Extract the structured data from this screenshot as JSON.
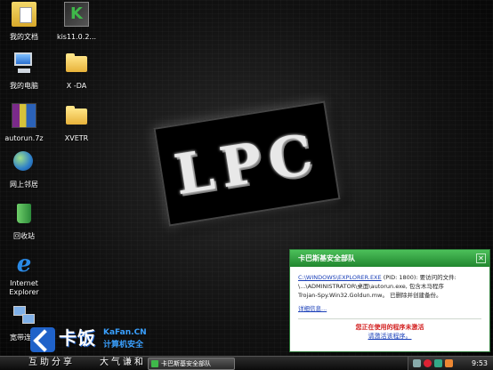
{
  "desktop": {
    "icons": {
      "my_documents": "我的文档",
      "kis_installer": "kis11.0.2...",
      "my_computer": "我的电脑",
      "folder_x_da": "X -DA",
      "autorun": "autorun.7z",
      "folder_xvetr": "XVETR",
      "network_places": "网上邻居",
      "recycle_bin": "回收站",
      "internet_explorer": "Internet Explorer",
      "broadband": "宽带连接"
    },
    "wallpaper_text": "LPC"
  },
  "notification": {
    "title": "卡巴斯基安全部队",
    "path_link": "C:\\WINDOWS\\EXPLORER.EXE",
    "line1_rest": " (PID: 1800): 要访问的文件:",
    "line2": "\\...\\ADMINISTRATOR\\桌面\\autorun.exe, 包含木马程序",
    "line3": "Trojan-Spy.Win32.Goldun.mw。 已删除并创建备份。",
    "details_link": "详细信息...",
    "warning": "您正在使用的程序未激活",
    "activate_link": "请激活该程序。"
  },
  "watermark": {
    "logo_cn": "卡饭",
    "logo_en": "KaFan.CN",
    "logo_sub": "计算机安全",
    "slogan_left": "互助分享",
    "slogan_right": "大气谦和"
  },
  "taskbar": {
    "task_button": "卡巴斯基安全部队",
    "clock": "9:53"
  },
  "colors": {
    "kaspersky_green": "#21862f",
    "link_blue": "#1a3fb8",
    "warning_red": "#d21c1c",
    "kafan_blue": "#1f62c9"
  }
}
